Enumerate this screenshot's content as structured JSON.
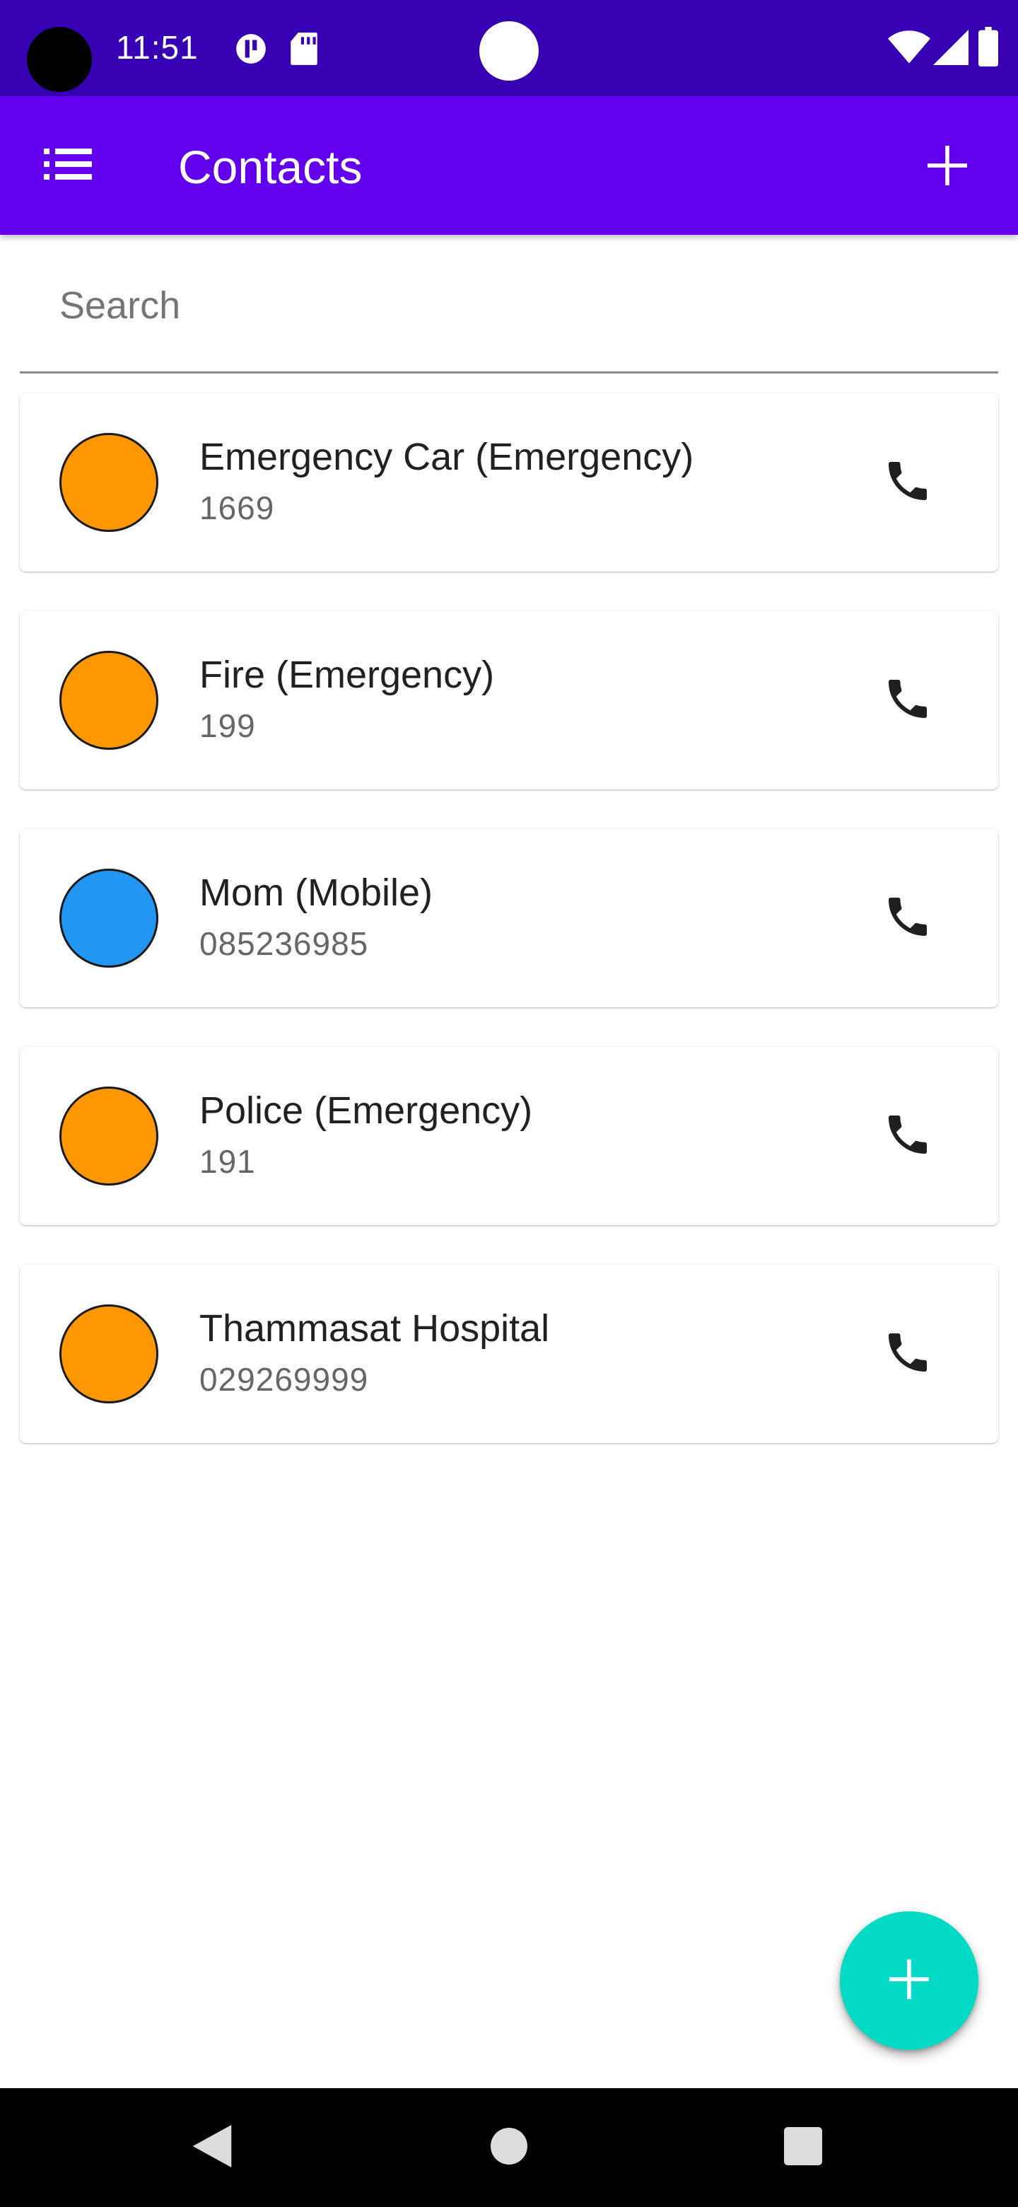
{
  "status_bar": {
    "time": "11:51",
    "icons": [
      "camera-hole",
      "data-saver-icon",
      "sd-card-icon",
      "wifi-icon",
      "signal-icon",
      "battery-icon"
    ]
  },
  "app_bar": {
    "title": "Contacts",
    "menu_icon": "list-icon",
    "add_icon": "plus-icon"
  },
  "search": {
    "placeholder": "Search",
    "value": ""
  },
  "contacts": [
    {
      "name": "Emergency Car (Emergency)",
      "number": "1669",
      "avatar_color": "#ff9800"
    },
    {
      "name": "Fire (Emergency)",
      "number": "199",
      "avatar_color": "#ff9800"
    },
    {
      "name": "Mom (Mobile)",
      "number": "085236985",
      "avatar_color": "#2196f3"
    },
    {
      "name": "Police (Emergency)",
      "number": "191",
      "avatar_color": "#ff9800"
    },
    {
      "name": "Thammasat Hospital",
      "number": "029269999",
      "avatar_color": "#ff9800"
    }
  ],
  "fab": {
    "icon": "plus-icon",
    "color": "#03dac5"
  },
  "colors": {
    "status_bar": "#3700b3",
    "app_bar": "#6200ee",
    "emergency_avatar": "#ff9800",
    "mobile_avatar": "#2196f3"
  }
}
